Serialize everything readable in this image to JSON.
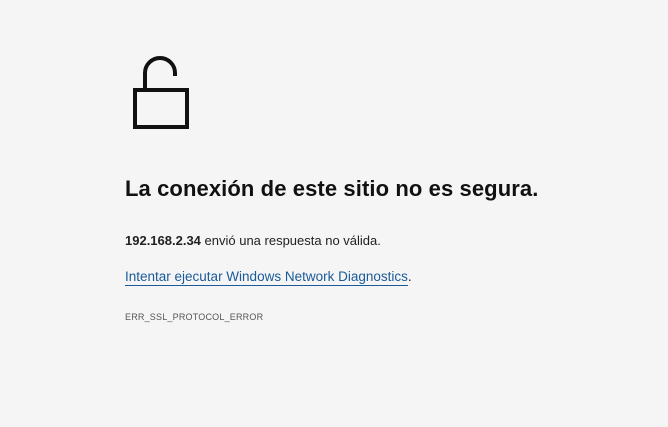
{
  "icon": "unlocked-padlock-icon",
  "title": "La conexión de este sitio no es segura.",
  "message": {
    "host": "192.168.2.34",
    "text": " envió una respuesta no válida."
  },
  "diagnostics": {
    "link_text": "Intentar ejecutar Windows Network Diagnostics",
    "trailing": "."
  },
  "error_code": "ERR_SSL_PROTOCOL_ERROR",
  "colors": {
    "background": "#f5f5f5",
    "link": "#1a5a9a",
    "text": "#1b1b1b"
  }
}
